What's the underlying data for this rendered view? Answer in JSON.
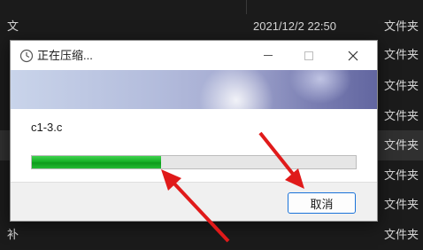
{
  "background_list": {
    "rows": [
      {
        "name": "文",
        "date": "2021/12/2 22:50",
        "type": "文件夹"
      },
      {
        "name": "",
        "date": "",
        "type": "文件夹"
      },
      {
        "name": "",
        "date": "",
        "type": "文件夹"
      },
      {
        "name": "",
        "date": "",
        "type": "文件夹"
      },
      {
        "name": "",
        "date": "",
        "type": "文件夹"
      },
      {
        "name": "",
        "date": "",
        "type": "文件夹"
      },
      {
        "name": "",
        "date": "",
        "type": "文件夹"
      },
      {
        "name": "补",
        "date": "",
        "type": "文件夹"
      }
    ]
  },
  "dialog": {
    "title": "正在压缩...",
    "current_file": "c1-3.c",
    "progress_fraction": 0.4,
    "cancel_label": "取消",
    "accent_color": "#16b026"
  },
  "annotation_color": "#e01a1a"
}
